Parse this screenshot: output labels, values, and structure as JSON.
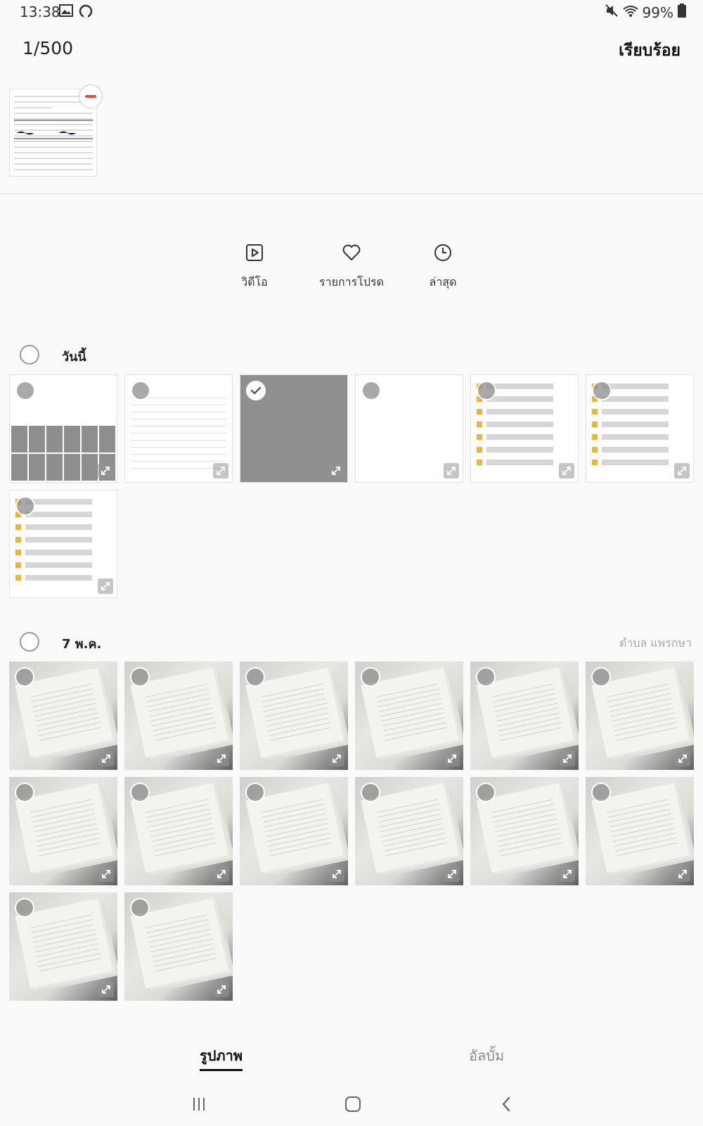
{
  "status_bar": {
    "time": "13:38",
    "battery": "99%",
    "icons": [
      "gallery-icon",
      "sync-icon",
      "mute-icon",
      "wifi-icon",
      "battery-icon"
    ]
  },
  "header": {
    "counter": "1/500",
    "done_label": "เรียบร้อย"
  },
  "selected_tray": {
    "items": [
      {
        "kind": "document",
        "remove_icon": "minus-icon"
      }
    ]
  },
  "shortcuts": [
    {
      "label": "วิดีโอ",
      "icon": "video-icon"
    },
    {
      "label": "รายการโปรด",
      "icon": "heart-icon"
    },
    {
      "label": "ล่าสุด",
      "icon": "clock-icon"
    }
  ],
  "sections": [
    {
      "title": "วันนี้",
      "location": "",
      "items": [
        {
          "kind": "gridimg",
          "checked": false
        },
        {
          "kind": "doc",
          "checked": false
        },
        {
          "kind": "dark",
          "checked": true
        },
        {
          "kind": "blank",
          "checked": false
        },
        {
          "kind": "list",
          "checked": false
        },
        {
          "kind": "list",
          "checked": false
        },
        {
          "kind": "list",
          "checked": false
        }
      ]
    },
    {
      "title": "7 พ.ค.",
      "location": "ตำบล แพรกษา",
      "items": [
        {
          "kind": "photo",
          "checked": false
        },
        {
          "kind": "photo",
          "checked": false
        },
        {
          "kind": "photo",
          "checked": false
        },
        {
          "kind": "photo",
          "checked": false
        },
        {
          "kind": "photo",
          "checked": false
        },
        {
          "kind": "photo",
          "checked": false
        },
        {
          "kind": "photo",
          "checked": false
        },
        {
          "kind": "photo",
          "checked": false
        },
        {
          "kind": "photo",
          "checked": false
        },
        {
          "kind": "photo",
          "checked": false
        },
        {
          "kind": "photo",
          "checked": false
        },
        {
          "kind": "photo",
          "checked": false
        },
        {
          "kind": "photo",
          "checked": false
        },
        {
          "kind": "photo",
          "checked": false
        }
      ]
    }
  ],
  "bottom_tabs": {
    "pictures_label": "รูปภาพ",
    "albums_label": "อัลบั้ม",
    "active": "pictures"
  },
  "nav_bar": {
    "icons": [
      "recent-apps-icon",
      "home-icon",
      "back-icon"
    ]
  }
}
